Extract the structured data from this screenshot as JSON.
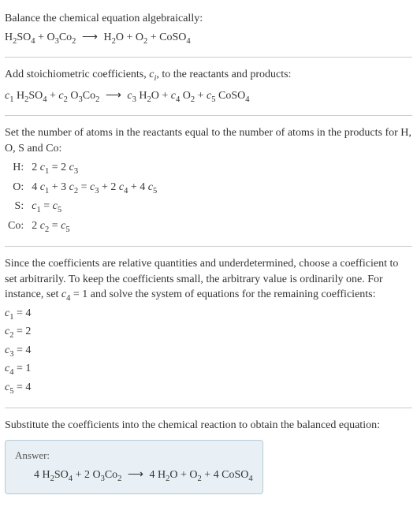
{
  "title": "Balance the chemical equation algebraically:",
  "unbalanced_equation_parts": {
    "r1": "H",
    "r1s1": "2",
    "r1b": "SO",
    "r1s2": "4",
    "plus1": " + ",
    "r2": "O",
    "r2s1": "3",
    "r2b": "Co",
    "r2s2": "2",
    "arrow": "⟶",
    "p1": "H",
    "p1s1": "2",
    "p1b": "O",
    "plus2": " + ",
    "p2": "O",
    "p2s1": "2",
    "plus3": " + ",
    "p3": "CoSO",
    "p3s1": "4"
  },
  "stoich_intro_a": "Add stoichiometric coefficients, ",
  "stoich_intro_c": "c",
  "stoich_intro_i": "i",
  "stoich_intro_b": ", to the reactants and products:",
  "stoich_eq": {
    "c1": "c",
    "c1s": "1",
    "sp1": " H",
    "sp1s1": "2",
    "sp1b": "SO",
    "sp1s2": "4",
    "plus1": " + ",
    "c2": "c",
    "c2s": "2",
    "sp2": " O",
    "sp2s1": "3",
    "sp2b": "Co",
    "sp2s2": "2",
    "arrow": "⟶",
    "c3": "c",
    "c3s": "3",
    "sp3": " H",
    "sp3s1": "2",
    "sp3b": "O",
    "plus2": " + ",
    "c4": "c",
    "c4s": "4",
    "sp4": " O",
    "sp4s1": "2",
    "plus3": " + ",
    "c5": "c",
    "c5s": "5",
    "sp5": " CoSO",
    "sp5s1": "4"
  },
  "atoms_intro": "Set the number of atoms in the reactants equal to the number of atoms in the products for H, O, S and Co:",
  "atom_rows": {
    "h_label": "H:",
    "h_eq_a": "2 ",
    "h_c1": "c",
    "h_c1s": "1",
    "h_eq_b": " = 2 ",
    "h_c3": "c",
    "h_c3s": "3",
    "o_label": "O:",
    "o_eq_a": "4 ",
    "o_c1": "c",
    "o_c1s": "1",
    "o_eq_b": " + 3 ",
    "o_c2": "c",
    "o_c2s": "2",
    "o_eq_c": " = ",
    "o_c3": "c",
    "o_c3s": "3",
    "o_eq_d": " + 2 ",
    "o_c4": "c",
    "o_c4s": "4",
    "o_eq_e": " + 4 ",
    "o_c5": "c",
    "o_c5s": "5",
    "s_label": "S:",
    "s_c1": "c",
    "s_c1s": "1",
    "s_eq_a": " = ",
    "s_c5": "c",
    "s_c5s": "5",
    "co_label": "Co:",
    "co_eq_a": "2 ",
    "co_c2": "c",
    "co_c2s": "2",
    "co_eq_b": " = ",
    "co_c5": "c",
    "co_c5s": "5"
  },
  "underdet_a": "Since the coefficients are relative quantities and underdetermined, choose a coefficient to set arbitrarily. To keep the coefficients small, the arbitrary value is ordinarily one. For instance, set ",
  "underdet_c4": "c",
  "underdet_c4s": "4",
  "underdet_b": " = 1 and solve the system of equations for the remaining coefficients:",
  "solutions": {
    "c1": "c",
    "c1s": "1",
    "c1v": " = 4",
    "c2": "c",
    "c2s": "2",
    "c2v": " = 2",
    "c3": "c",
    "c3s": "3",
    "c3v": " = 4",
    "c4": "c",
    "c4s": "4",
    "c4v": " = 1",
    "c5": "c",
    "c5s": "5",
    "c5v": " = 4"
  },
  "subst_text": "Substitute the coefficients into the chemical reaction to obtain the balanced equation:",
  "answer_label": "Answer:",
  "balanced": {
    "n1": "4 H",
    "n1s1": "2",
    "n1b": "SO",
    "n1s2": "4",
    "plus1": " + ",
    "n2": "2 O",
    "n2s1": "3",
    "n2b": "Co",
    "n2s2": "2",
    "arrow": "⟶",
    "n3": "4 H",
    "n3s1": "2",
    "n3b": "O",
    "plus2": " + ",
    "n4": "O",
    "n4s1": "2",
    "plus3": " + ",
    "n5": "4 CoSO",
    "n5s1": "4"
  },
  "chart_data": {
    "type": "table",
    "title": "Balanced chemical equation coefficients",
    "unbalanced_equation": "H2SO4 + O3Co2 ⟶ H2O + O2 + CoSO4",
    "stoichiometric_equation": "c1 H2SO4 + c2 O3Co2 ⟶ c3 H2O + c4 O2 + c5 CoSO4",
    "atom_balance": [
      {
        "element": "H",
        "equation": "2 c1 = 2 c3"
      },
      {
        "element": "O",
        "equation": "4 c1 + 3 c2 = c3 + 2 c4 + 4 c5"
      },
      {
        "element": "S",
        "equation": "c1 = c5"
      },
      {
        "element": "Co",
        "equation": "2 c2 = c5"
      }
    ],
    "set_value": {
      "coefficient": "c4",
      "value": 1
    },
    "solution": {
      "c1": 4,
      "c2": 2,
      "c3": 4,
      "c4": 1,
      "c5": 4
    },
    "balanced_equation": "4 H2SO4 + 2 O3Co2 ⟶ 4 H2O + O2 + 4 CoSO4"
  }
}
